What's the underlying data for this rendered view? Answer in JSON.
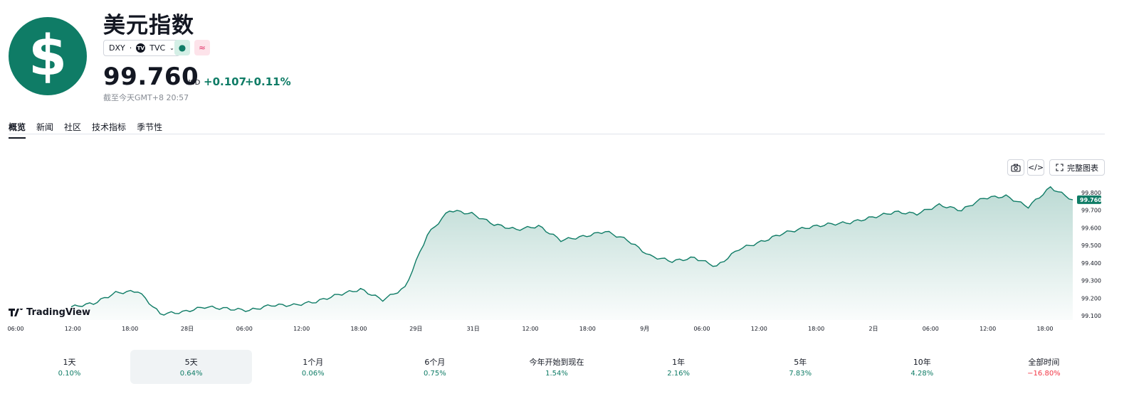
{
  "header": {
    "logo_symbol": "$",
    "title": "美元指数",
    "ticker": "DXY",
    "exchange_icon": "TV",
    "exchange": "TVC",
    "status_icon": "●",
    "delay_icon": "≈",
    "price": "99.760",
    "currency": "USD",
    "change": "+0.107",
    "change_pct": "+0.11%",
    "as_of": "截至今天GMT+8 20:57"
  },
  "tabs": [
    "概览",
    "新闻",
    "社区",
    "技术指标",
    "季节性"
  ],
  "toolbar": {
    "full_chart_label": "完整图表"
  },
  "watermark": "TradingView",
  "chart_data": {
    "type": "area",
    "x_tick_labels": [
      "06:00",
      "12:00",
      "18:00",
      "28日",
      "06:00",
      "12:00",
      "18:00",
      "29日",
      "31日",
      "12:00",
      "18:00",
      "9月",
      "06:00",
      "12:00",
      "18:00",
      "2日",
      "06:00",
      "12:00",
      "18:00"
    ],
    "y_tick_labels": [
      "99.800",
      "99.700",
      "99.600",
      "99.500",
      "99.400",
      "99.300",
      "99.200",
      "99.100"
    ],
    "ylim": [
      99.1,
      99.8
    ],
    "last_value_label": "99.760",
    "x": [
      0,
      4,
      8,
      12,
      16,
      20,
      24,
      28,
      32,
      36,
      40,
      44,
      48,
      52,
      56,
      60,
      64,
      68,
      72,
      76,
      80,
      84,
      88,
      92,
      96,
      100
    ],
    "values": [
      99.15,
      99.17,
      99.23,
      99.24,
      99.11,
      99.12,
      99.15,
      99.14,
      99.13,
      99.16,
      99.16,
      99.18,
      99.22,
      99.25,
      99.19,
      99.26,
      99.56,
      99.7,
      99.68,
      99.62,
      99.59,
      99.61,
      99.53,
      99.55,
      99.58,
      99.53,
      99.44,
      99.41,
      99.43,
      99.38,
      99.48,
      99.52,
      99.57,
      99.6,
      99.62,
      99.63,
      99.66,
      99.69,
      99.68,
      99.73,
      99.7,
      99.77,
      99.78,
      99.72,
      99.83,
      99.76
    ],
    "grid": false,
    "color": "#0f7c66"
  },
  "periods": [
    {
      "label": "1天",
      "value": "0.10%",
      "sign": "pos"
    },
    {
      "label": "5天",
      "value": "0.64%",
      "sign": "pos"
    },
    {
      "label": "1个月",
      "value": "0.06%",
      "sign": "pos"
    },
    {
      "label": "6个月",
      "value": "0.75%",
      "sign": "pos"
    },
    {
      "label": "今年开始到现在",
      "value": "1.54%",
      "sign": "pos"
    },
    {
      "label": "1年",
      "value": "2.16%",
      "sign": "pos"
    },
    {
      "label": "5年",
      "value": "7.83%",
      "sign": "pos"
    },
    {
      "label": "10年",
      "value": "4.28%",
      "sign": "pos"
    },
    {
      "label": "全部时间",
      "value": "−16.80%",
      "sign": "neg"
    }
  ]
}
